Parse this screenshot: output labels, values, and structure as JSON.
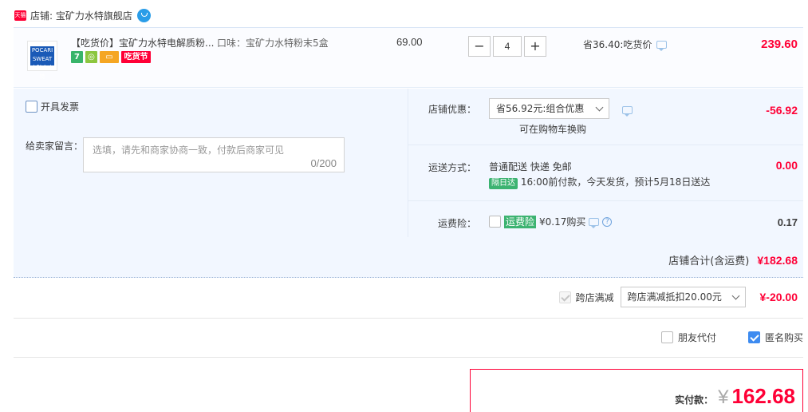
{
  "shop": {
    "tmall_badge": "天猫",
    "label": "店铺: 宝矿力水特旗舰店"
  },
  "item": {
    "thumb_text": "POCARI SWEAT 宝矿力水特",
    "title": "【吃货价】宝矿力水特电解质粉...",
    "sku": "口味：宝矿力水特粉末5盒",
    "unit_price": "69.00",
    "qty_minus": "−",
    "qty": "4",
    "qty_plus": "+",
    "save_note": "省36.40:吃货价",
    "total": "239.60",
    "badges": [
      "7",
      "",
      "",
      "吃货节"
    ]
  },
  "invoice_label": "开具发票",
  "message": {
    "label": "给卖家留言：",
    "placeholder": "选填，请先和商家协商一致，付款后商家可见",
    "count": "0/200"
  },
  "discount": {
    "label": "店铺优惠：",
    "selected": "省56.92元:组合优惠",
    "sub_link": "可在购物车换购",
    "value": "-56.92"
  },
  "shipping": {
    "label": "运送方式：",
    "method": "普通配送 快递 免邮",
    "tag": "隔日达",
    "note": "16:00前付款，今天发货，预计5月18日送达",
    "value": "0.00"
  },
  "insurance": {
    "label": "运费险：",
    "tag": "运费险",
    "price": "¥0.17购买",
    "help": "?",
    "value": "0.17"
  },
  "store_total": {
    "label": "店铺合计(含运费)",
    "value": "¥182.68"
  },
  "cross_store": {
    "label": "跨店满减",
    "selected": "跨店满减抵扣20.00元",
    "value": "¥-20.00"
  },
  "options": {
    "friend_pay": "朋友代付",
    "anonymous": "匿名购买"
  },
  "pay": {
    "label": "实付款：",
    "currency": "¥",
    "value": "162.68"
  },
  "colors": {
    "accent": "#ff0036",
    "panel_bg": "#f2f7ff",
    "link_blue": "#3d8bf0"
  }
}
